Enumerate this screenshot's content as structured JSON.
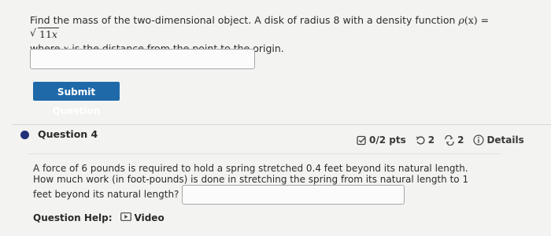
{
  "question3": {
    "prompt_part1": "Find the mass of the two-dimensional object. A disk of radius 8 with a density function ",
    "rho": "ρ",
    "rho_arg": "(x)",
    "equals": " = ",
    "sqrt_content_num": "11",
    "sqrt_content_var": "x",
    "prompt_part2": "where ",
    "var_x": "x",
    "prompt_part3": " is the distance from the point to the origin.",
    "answer_value": ""
  },
  "submit": {
    "label": "Submit Question"
  },
  "question4": {
    "title": "Question 4",
    "points": "0/2 pts",
    "retries": "2",
    "attempts": "2",
    "details_label": "Details",
    "text": "A force of 6 pounds is required to hold a spring stretched 0.4 feet beyond its natural length. How much work (in foot-pounds) is done in stretching the spring from its natural length to 1 feet beyond its natural length?",
    "answer_value": "",
    "help_label": "Question Help:",
    "video_label": "Video"
  },
  "icons": {
    "bullet": "bullet-icon",
    "points": "gradebook-check-icon",
    "retry": "retry-icon",
    "attempts": "attempts-icon",
    "details": "info-icon",
    "video": "video-play-icon"
  },
  "colors": {
    "submit_bg": "#1f69a8",
    "bullet": "#222f7a"
  }
}
